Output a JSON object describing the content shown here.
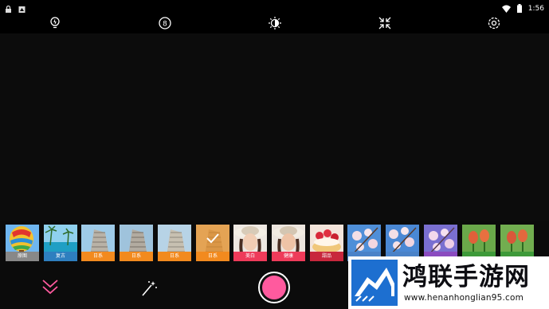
{
  "status_bar": {
    "left_icons": [
      "lock-icon",
      "notification-icon"
    ],
    "right_icons": [
      "wifi-icon",
      "battery-icon"
    ],
    "time": "1:56"
  },
  "toolbar": {
    "icons": [
      "bulb-icon",
      "timer-icon",
      "brightness-icon",
      "collapse-icon",
      "settings-icon"
    ]
  },
  "filters": [
    {
      "label": "原图",
      "thumb": "balloon",
      "label_color": "#888888"
    },
    {
      "label": "复古",
      "thumb": "beach",
      "label_color": "#2e7fbf"
    },
    {
      "label": "日系",
      "thumb": "building",
      "label_color": "#f28a1e"
    },
    {
      "label": "日系",
      "thumb": "building",
      "label_color": "#f28a1e"
    },
    {
      "label": "日系",
      "thumb": "building",
      "label_color": "#f28a1e"
    },
    {
      "label": "日系",
      "thumb": "building",
      "label_color": "#f28a1e",
      "selected": true
    },
    {
      "label": "美白",
      "thumb": "portrait",
      "label_color": "#ee3b5a"
    },
    {
      "label": "健康",
      "thumb": "portrait",
      "label_color": "#ee3b5a"
    },
    {
      "label": "甜品",
      "thumb": "cake",
      "label_color": "#c8273c"
    },
    {
      "label": "",
      "thumb": "blossom",
      "label_color": "#4a82c8"
    },
    {
      "label": "",
      "thumb": "blossom",
      "label_color": "#4a82c8"
    },
    {
      "label": "",
      "thumb": "blossom",
      "label_color": "#8a4bbf"
    },
    {
      "label": "",
      "thumb": "tulip",
      "label_color": "#3e9a3a"
    },
    {
      "label": "",
      "thumb": "tulip",
      "label_color": "#3e9a3a"
    }
  ],
  "bottom_bar": {
    "left_icon": "chevron-double-down-icon",
    "magic_icon": "magic-wand-icon",
    "accent": "#ff5a9e"
  },
  "watermark": {
    "title": "鸿联手游网",
    "url": "www.henanhonglian95.com"
  }
}
